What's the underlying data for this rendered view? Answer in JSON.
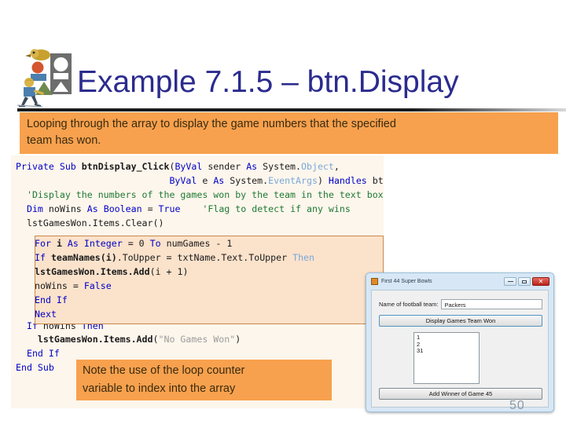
{
  "slide": {
    "title": "Example 7.1.5 – btn.Display",
    "page_number": "50",
    "clipart_name": "people-and-shapes-clipart"
  },
  "callout_top": {
    "line1": "Looping through the array to display the game numbers that the specified",
    "line2": "team has won."
  },
  "callout_bottom": {
    "line1": "Note the use of the loop counter",
    "line2": "variable to index into the array"
  },
  "code": {
    "lines": [
      "Private Sub btnDisplay_Click(ByVal sender As System.Object,",
      "                            ByVal e As System.EventArgs) Handles bt",
      "  'Display the numbers of the games won by the team in the text box",
      "  Dim noWins As Boolean = True    'Flag to detect if any wins",
      "  lstGamesWon.Items.Clear()"
    ],
    "loop_lines": [
      "  For i As Integer = 0 To numGames - 1",
      "    If teamNames(i).ToUpper = txtName.Text.ToUpper Then",
      "      lstGamesWon.Items.Add(i + 1)",
      "      noWins = False",
      "    End If",
      "  Next"
    ],
    "tail_lines": [
      "  If noWins Then",
      "    lstGamesWon.Items.Add(\"No Games Won\")",
      "  End If",
      "End Sub"
    ]
  },
  "form": {
    "title": "First 44 Super Bowls",
    "minimize_label": "–",
    "maximize_label": "□",
    "close_label": "✕",
    "field_label": "Name of football team:",
    "field_value": "Packers",
    "display_button": "Display Games Team Won",
    "listbox_items": [
      "1",
      "2",
      "31"
    ],
    "add_button": "Add Winner of Game 45"
  },
  "colors": {
    "title_blue": "#2b2b8f",
    "callout_orange": "#f7a14e",
    "code_bg": "#fdf6ec",
    "loop_highlight": "#fbe2cb"
  }
}
